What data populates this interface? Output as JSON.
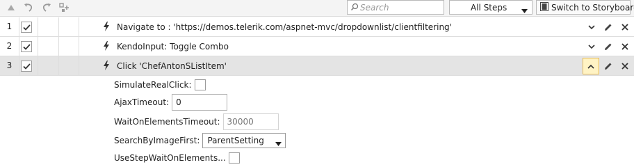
{
  "toolbar": {
    "icons": [
      "move-up-icon",
      "undo-icon",
      "redo-icon",
      "step-settings-icon"
    ],
    "search": {
      "placeholder": "Search",
      "value": "",
      "icon": "search-icon"
    },
    "steps_filter": {
      "selected": "All Steps"
    },
    "storyboard_button": {
      "label": "Switch to Storyboard",
      "icon": "storyboard-icon"
    }
  },
  "steps": [
    {
      "number": "1",
      "checked": true,
      "icon": "lightning-icon",
      "description": "Navigate to : 'https://demos.telerik.com/aspnet-mvc/dropdownlist/clientfiltering'",
      "expanded": false,
      "selected": false
    },
    {
      "number": "2",
      "checked": true,
      "icon": "lightning-icon",
      "description": "KendoInput: Toggle Combo",
      "expanded": false,
      "selected": false
    },
    {
      "number": "3",
      "checked": true,
      "icon": "lightning-icon",
      "description": "Click 'ChefAntonSListItem'",
      "expanded": true,
      "selected": true
    }
  ],
  "properties": {
    "simulate_real_click": {
      "label": "SimulateRealClick:",
      "checked": false
    },
    "ajax_timeout": {
      "label": "AjaxTimeout:",
      "value": "0"
    },
    "wait_on_elements_timeout": {
      "label": "WaitOnElementsTimeout:",
      "placeholder": "30000"
    },
    "search_by_image_first": {
      "label": "SearchByImageFirst:",
      "selected": "ParentSetting"
    },
    "use_step_wait_on_elements": {
      "label": "UseStepWaitOnElements...",
      "checked": false
    }
  },
  "colors": {
    "toolbar_bg": "#f4f4f4",
    "selected_row_bg": "#e4e4e4",
    "expand_button_bg": "#fff3c4",
    "expand_button_border": "#e5b955",
    "grid_line": "#dedede"
  }
}
